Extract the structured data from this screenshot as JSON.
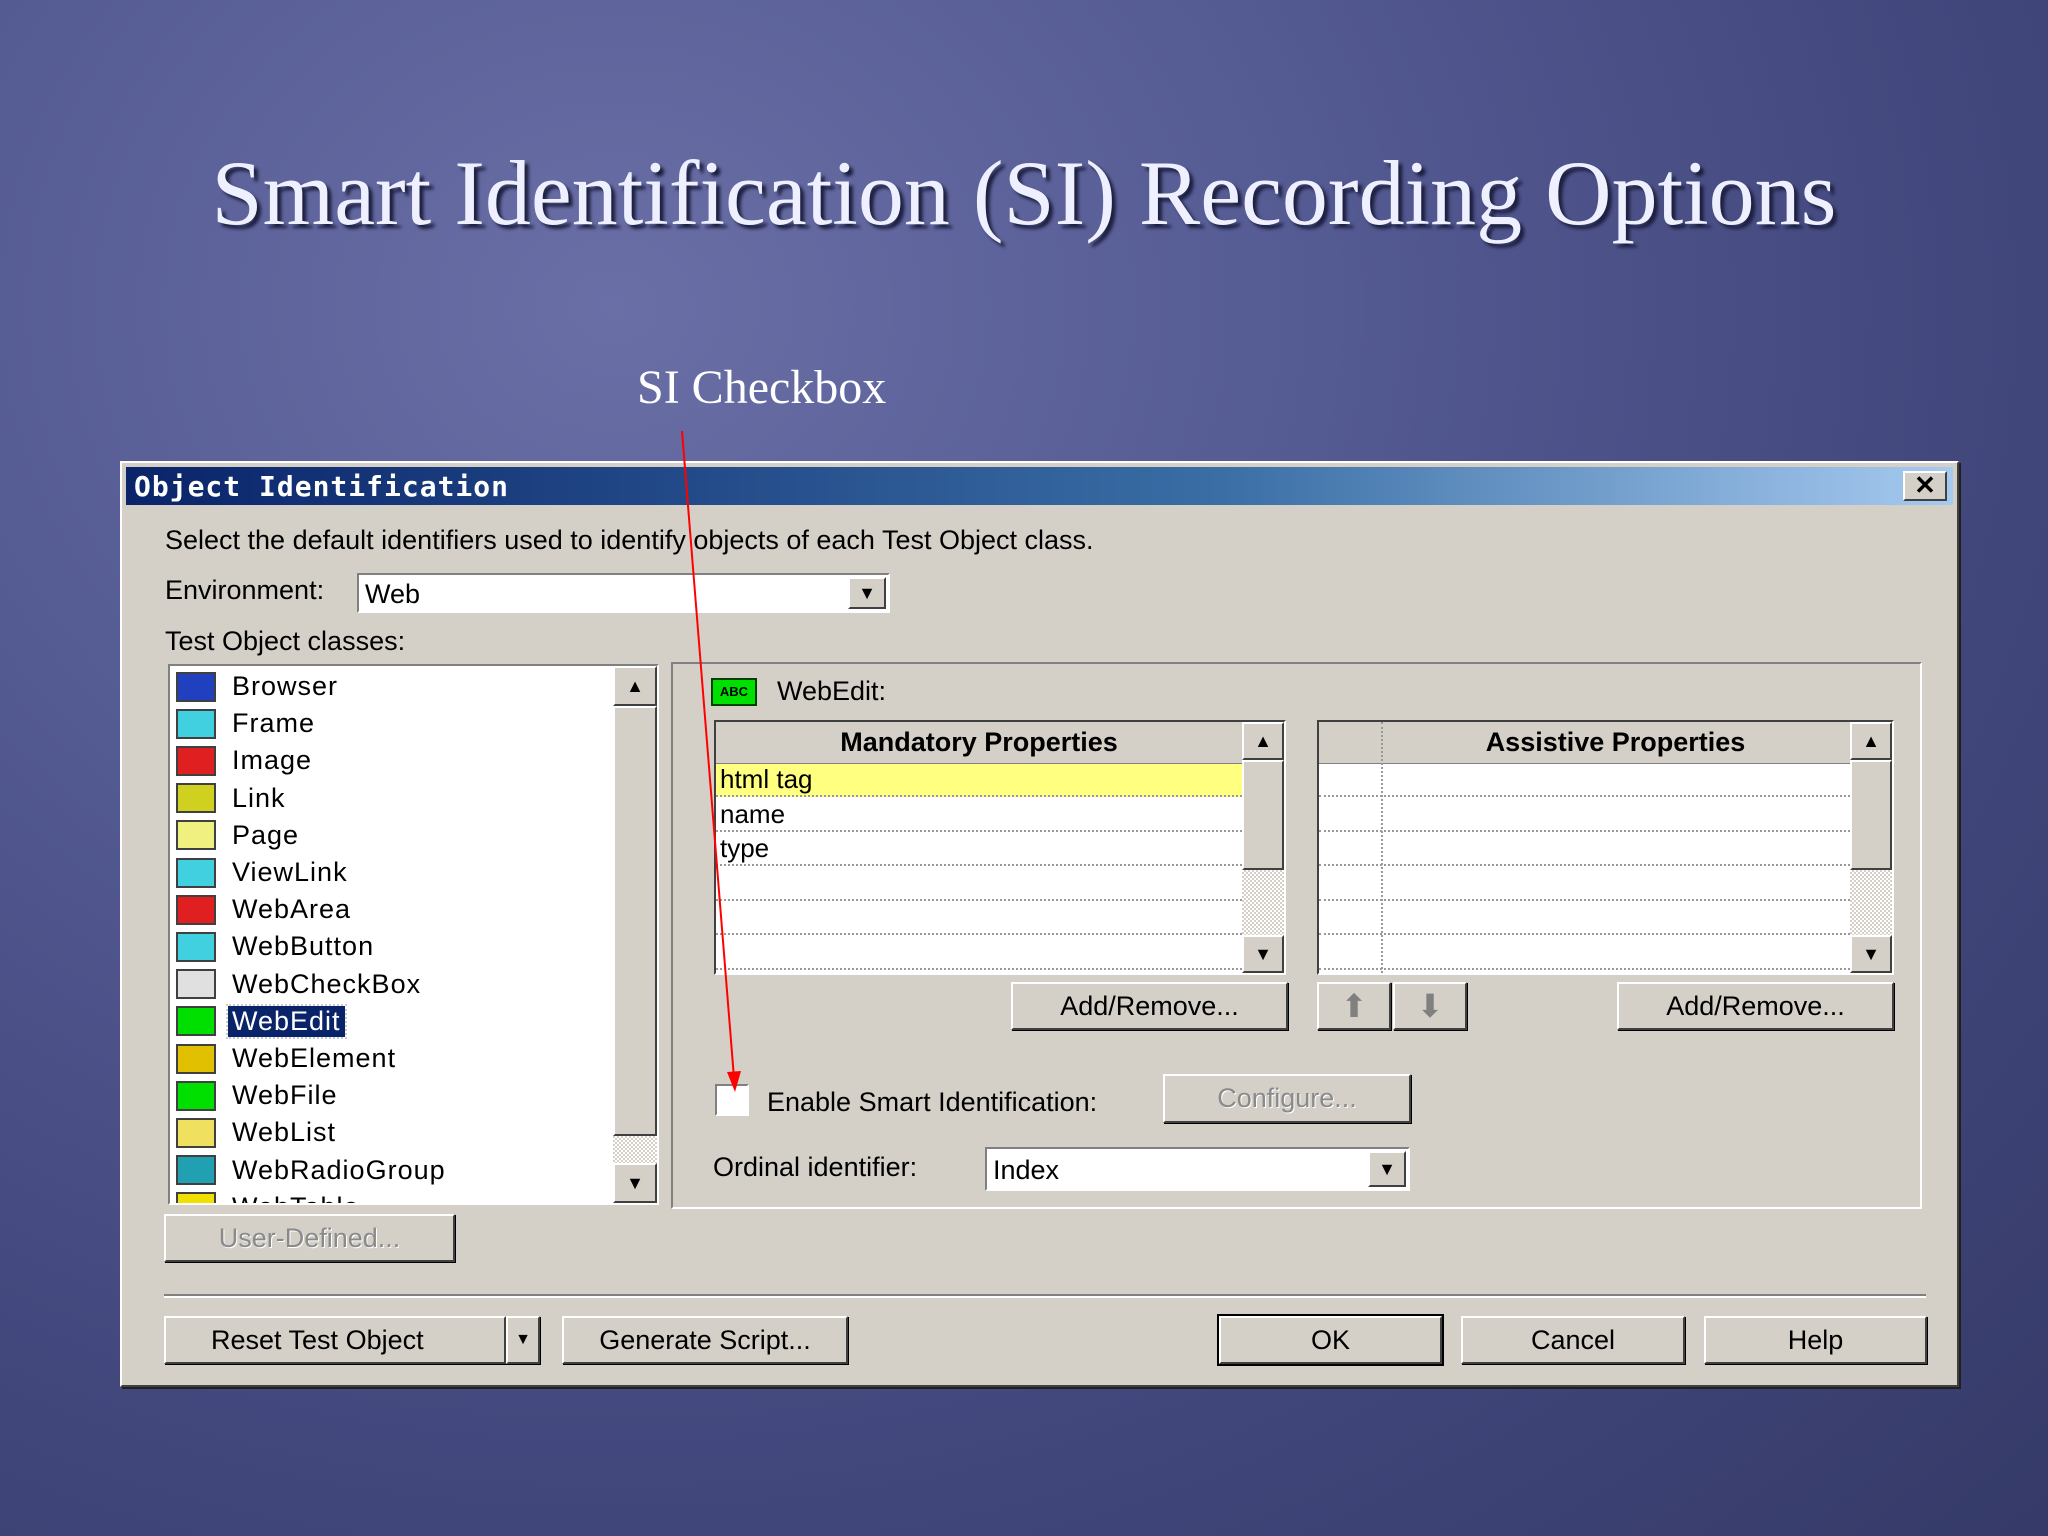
{
  "slide": {
    "title": "Smart Identification (SI) Recording Options",
    "callout": "SI Checkbox"
  },
  "dialog": {
    "title": "Object Identification",
    "close_icon": "close-icon",
    "instruction": "Select the default identifiers used to identify objects of each Test Object class.",
    "environment_label": "Environment:",
    "environment_value": "Web",
    "classes_label": "Test Object classes:",
    "classes": [
      {
        "label": "Browser",
        "icon": "browser-icon"
      },
      {
        "label": "Frame",
        "icon": "frame-icon"
      },
      {
        "label": "Image",
        "icon": "image-icon"
      },
      {
        "label": "Link",
        "icon": "link-icon"
      },
      {
        "label": "Page",
        "icon": "page-icon"
      },
      {
        "label": "ViewLink",
        "icon": "viewlink-icon"
      },
      {
        "label": "WebArea",
        "icon": "webarea-icon"
      },
      {
        "label": "WebButton",
        "icon": "webbutton-icon"
      },
      {
        "label": "WebCheckBox",
        "icon": "webcheckbox-icon"
      },
      {
        "label": "WebEdit",
        "icon": "webedit-icon",
        "selected": true
      },
      {
        "label": "WebElement",
        "icon": "webelement-icon"
      },
      {
        "label": "WebFile",
        "icon": "webfile-icon"
      },
      {
        "label": "WebList",
        "icon": "weblist-icon"
      },
      {
        "label": "WebRadioGroup",
        "icon": "webradiogroup-icon"
      },
      {
        "label": "WebTable",
        "icon": "webtable-icon"
      }
    ],
    "user_defined": "User-Defined...",
    "selected_class": "WebEdit:",
    "mandatory": {
      "header": "Mandatory Properties",
      "rows": [
        "html tag",
        "name",
        "type",
        "",
        "",
        ""
      ],
      "highlight": "#ffff80"
    },
    "assistive": {
      "header": "Assistive Properties",
      "rows": [
        "",
        "",
        "",
        "",
        "",
        ""
      ]
    },
    "add_remove": "Add/Remove...",
    "enable_si_label": "Enable Smart Identification:",
    "enable_si_checked": false,
    "configure": "Configure...",
    "ordinal_label": "Ordinal identifier:",
    "ordinal_value": "Index",
    "reset": "Reset Test Object",
    "generate": "Generate Script...",
    "ok": "OK",
    "cancel": "Cancel",
    "help": "Help"
  }
}
